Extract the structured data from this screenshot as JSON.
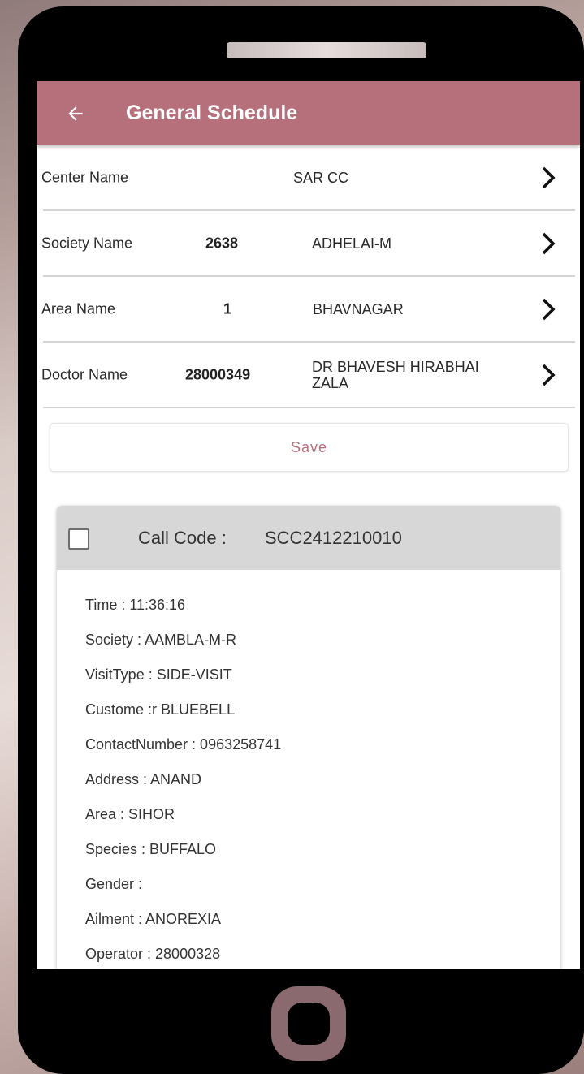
{
  "header": {
    "title": "General Schedule"
  },
  "form": {
    "center": {
      "label": "Center Name",
      "code": "",
      "value": "SAR CC"
    },
    "society": {
      "label": "Society Name",
      "code": "2638",
      "value": "ADHELAI-M"
    },
    "area": {
      "label": "Area Name",
      "code": "1",
      "value": "BHAVNAGAR"
    },
    "doctor": {
      "label": "Doctor Name",
      "code": "28000349",
      "value_line1": "DR BHAVESH HIRABHAI",
      "value_line2": "ZALA"
    }
  },
  "save_label": "Save",
  "card": {
    "call_code_label": "Call Code :",
    "call_code_value": "SCC2412210010",
    "time": "Time : 11:36:16",
    "society": "Society : AAMBLA-M-R",
    "visit_type": "VisitType : SIDE-VISIT",
    "customer": "Custome :r BLUEBELL",
    "contact": "ContactNumber : 0963258741",
    "address": "Address : ANAND",
    "area": "Area : SIHOR",
    "species": "Species : BUFFALO",
    "gender": "Gender :",
    "ailment": "Ailment : ANOREXIA",
    "operator": "Operator : 28000328"
  },
  "colors": {
    "accent": "#b5707c",
    "card_header": "#d7d7d7"
  },
  "icons": {
    "back": "arrow-left-icon",
    "chevron": "chevron-right-icon",
    "checkbox": "checkbox-unchecked"
  }
}
